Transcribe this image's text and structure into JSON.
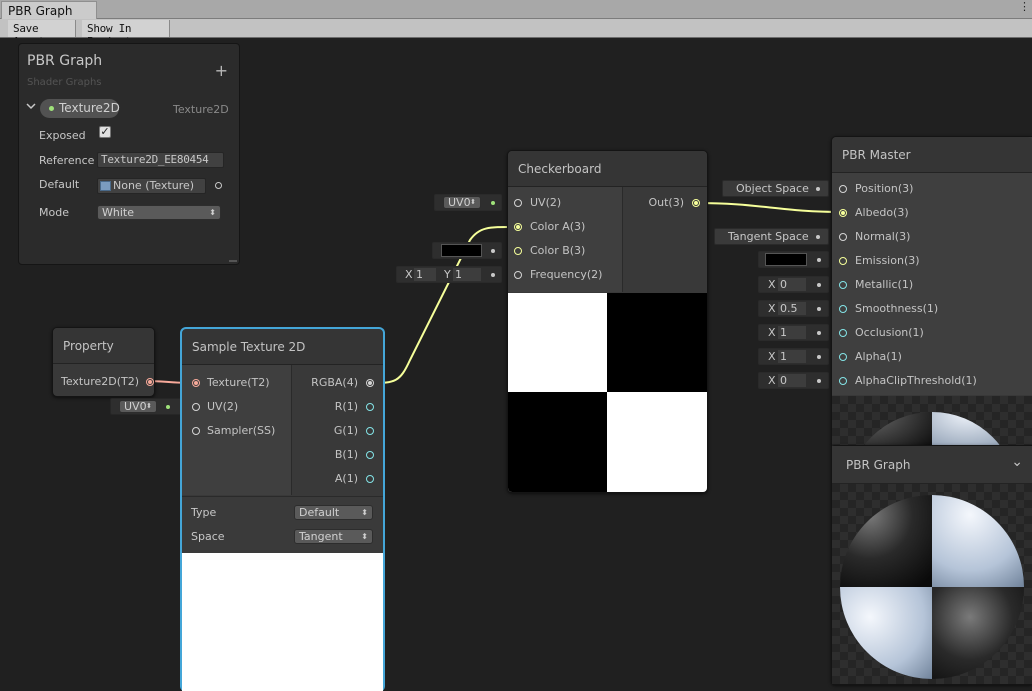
{
  "window": {
    "tab_title": "PBR Graph",
    "menu_glyph": "⋮"
  },
  "toolbar": {
    "save_asset": "Save Asset",
    "show_in_project": "Show In Project"
  },
  "blackboard": {
    "title": "PBR Graph",
    "subtitle": "Shader Graphs",
    "add_glyph": "+",
    "property": {
      "name": "Texture2D",
      "type": "Texture2D",
      "exposed_label": "Exposed",
      "exposed": true,
      "reference_label": "Reference",
      "reference_value": "Texture2D_EE80454",
      "default_label": "Default",
      "default_value": "None (Texture)",
      "mode_label": "Mode",
      "mode_value": "White"
    }
  },
  "property_node": {
    "title": "Property",
    "output": "Texture2D(T2)"
  },
  "sample_texture": {
    "title": "Sample Texture 2D",
    "inputs": [
      "Texture(T2)",
      "UV(2)",
      "Sampler(SS)"
    ],
    "outputs": [
      "RGBA(4)",
      "R(1)",
      "G(1)",
      "B(1)",
      "A(1)"
    ],
    "type_label": "Type",
    "type_value": "Default",
    "space_label": "Space",
    "space_value": "Tangent",
    "uv_inline": "UV0"
  },
  "checkerboard": {
    "title": "Checkerboard",
    "inputs": [
      "UV(2)",
      "Color A(3)",
      "Color B(3)",
      "Frequency(2)"
    ],
    "output": "Out(3)",
    "uv_inline": "UV0",
    "freq_x_label": "X",
    "freq_x": "1",
    "freq_y_label": "Y",
    "freq_y": "1"
  },
  "pbr_master": {
    "title": "PBR Master",
    "inputs": [
      "Position(3)",
      "Albedo(3)",
      "Normal(3)",
      "Emission(3)",
      "Metallic(1)",
      "Smoothness(1)",
      "Occlusion(1)",
      "Alpha(1)",
      "AlphaClipThreshold(1)"
    ],
    "position_inline": "Object Space",
    "normal_inline": "Tangent Space",
    "x_label": "X",
    "metallic": "0",
    "smoothness": "0.5",
    "occlusion": "1",
    "alpha": "1",
    "alpha_clip": "0"
  },
  "preview": {
    "title": "PBR Graph",
    "chevron": "⌄"
  },
  "colors": {
    "canvas": "#202020",
    "node": "#393939",
    "selected_outline": "#44a6d8",
    "vector3_port": "#f6ff9a",
    "vector1_port": "#84e4e7",
    "texture_port": "#f7a99a"
  }
}
